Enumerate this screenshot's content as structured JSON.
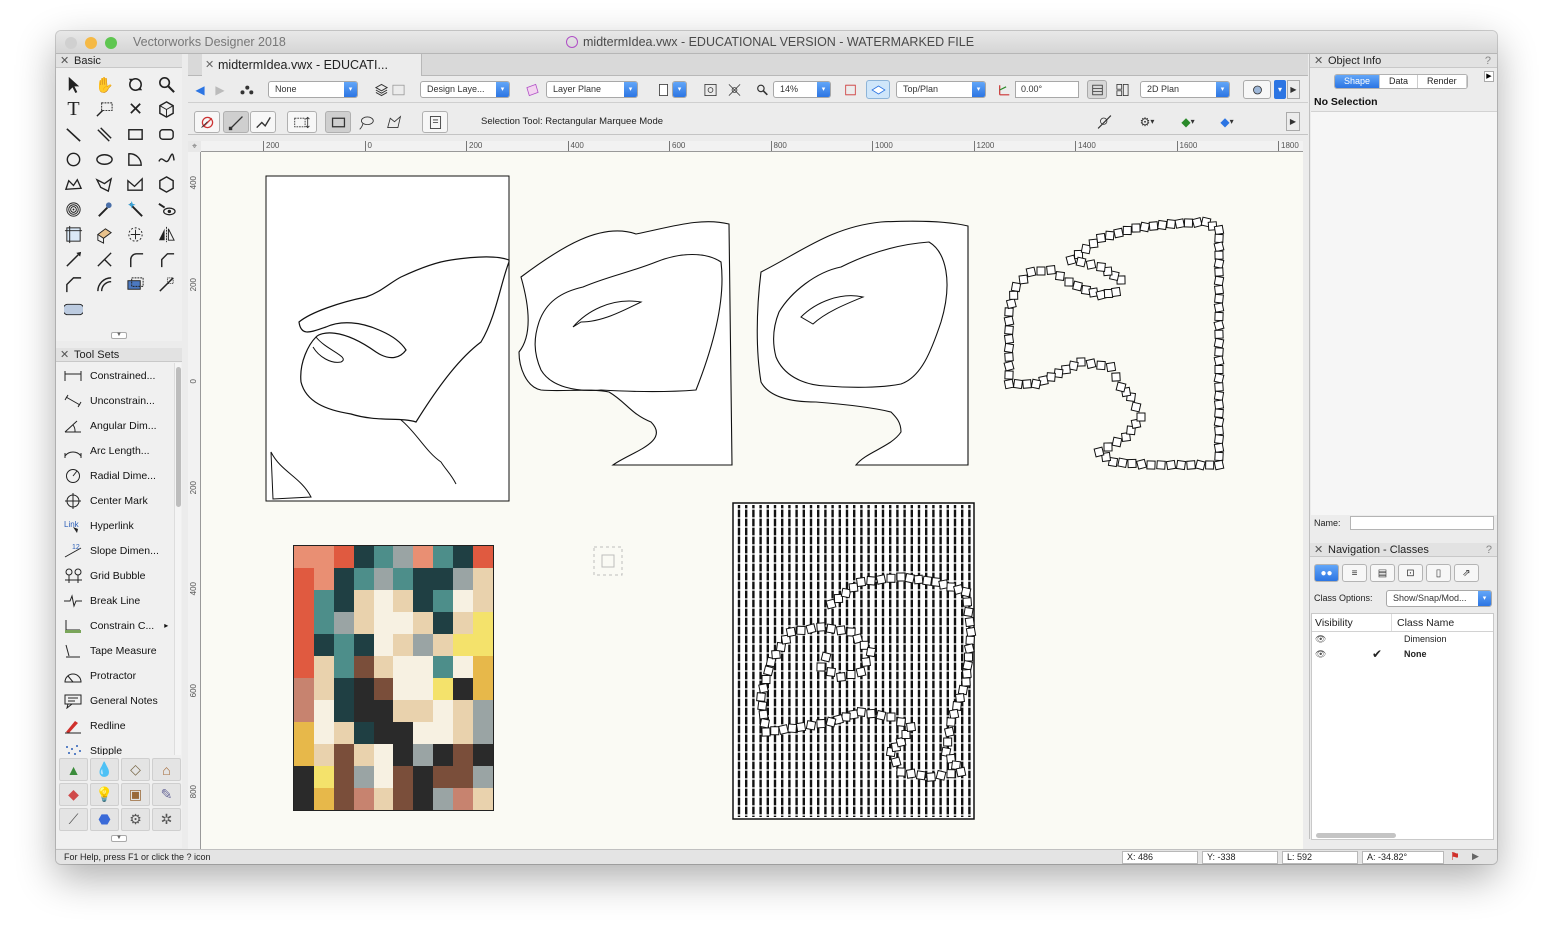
{
  "window": {
    "app_title": "Vectorworks Designer 2018",
    "document_title": "midtermIdea.vwx - EDUCATIONAL VERSION - WATERMARKED FILE",
    "traffic_lights": [
      "#d0d0d0",
      "#f5b945",
      "#5fc651"
    ]
  },
  "basic_palette": {
    "title": "Basic",
    "tools": [
      "selection-tool",
      "pan-tool",
      "flyover-tool",
      "zoom-tool",
      "text-tool",
      "callout-tool",
      "eraser-tool",
      "visualization-tool",
      "line-tool",
      "double-line-tool",
      "rectangle-tool",
      "rounded-rect-tool",
      "circle-tool",
      "oval-tool",
      "arc-tool",
      "freehand-tool",
      "polyline-tool",
      "polygon-tool",
      "double-polyline-tool",
      "regular-polygon-tool",
      "spiral-tool",
      "eyedropper-tool",
      "magic-wand-tool",
      "visibility-tool",
      "reshape-tool",
      "attribute-mapping-tool",
      "move-by-points-tool",
      "mirror-tool",
      "split-tool",
      "trim-tool",
      "fillet-tool",
      "chamfer-tool",
      "connect-tool",
      "offset-tool",
      "clip-tool",
      "clip-line-tool",
      "2d-reshape-tool"
    ]
  },
  "toolsets": {
    "title": "Tool Sets",
    "items": [
      {
        "label": "Constrained...",
        "icon": "constrained-dim-icon"
      },
      {
        "label": "Unconstrain...",
        "icon": "unconstrained-dim-icon"
      },
      {
        "label": "Angular Dim...",
        "icon": "angular-dim-icon"
      },
      {
        "label": "Arc Length...",
        "icon": "arc-length-icon"
      },
      {
        "label": "Radial Dime...",
        "icon": "radial-dim-icon"
      },
      {
        "label": "Center Mark",
        "icon": "center-mark-icon"
      },
      {
        "label": "Hyperlink",
        "icon": "hyperlink-icon"
      },
      {
        "label": "Slope Dimen...",
        "icon": "slope-dim-icon"
      },
      {
        "label": "Grid Bubble",
        "icon": "grid-bubble-icon"
      },
      {
        "label": "Break Line",
        "icon": "break-line-icon"
      },
      {
        "label": "Constrain C...",
        "icon": "constrain-icon",
        "submenu": "▸"
      },
      {
        "label": "Tape Measure",
        "icon": "tape-measure-icon"
      },
      {
        "label": "Protractor",
        "icon": "protractor-icon"
      },
      {
        "label": "General Notes",
        "icon": "general-notes-icon"
      },
      {
        "label": "Redline",
        "icon": "redline-icon"
      },
      {
        "label": "Stipple",
        "icon": "stipple-icon"
      }
    ],
    "set_icons": [
      "site-planning-set-icon",
      "landscape-set-icon",
      "building-shell-set-icon",
      "furniture-set-icon",
      "visualization-set-icon",
      "lighting-set-icon",
      "fabrication-set-icon",
      "detailing-set-icon",
      "dims-notes-set-icon",
      "piping-set-icon",
      "machine-components-set-icon",
      "more-sets-icon"
    ]
  },
  "tabs": {
    "active_label": "midtermIdea.vwx - EDUCATI...",
    "close_glyph": "✕"
  },
  "view_bar": {
    "class_value": "None",
    "layer_value": "Design Laye...",
    "plane_value": "Layer Plane",
    "zoom_value": "14%",
    "view_value": "Top/Plan",
    "rotation_value": "0.00°",
    "render_mode_value": "2D Plan"
  },
  "mode_bar": {
    "status_text": "Selection Tool: Rectangular Marquee Mode"
  },
  "rulers": {
    "top_labels": [
      "200",
      "0",
      "200",
      "400",
      "600",
      "800",
      "1000",
      "1200",
      "1400",
      "1600",
      "1800"
    ],
    "left_labels": [
      "400",
      "200",
      "0",
      "200",
      "400",
      "600",
      "800"
    ],
    "corner_glyph": "⌖"
  },
  "object_info": {
    "title": "Object Info",
    "tabs": [
      "Shape",
      "Data",
      "Render"
    ],
    "active_tab": "Shape",
    "selection": "No Selection",
    "name_label": "Name:",
    "name_value": "",
    "help_glyph": "?"
  },
  "navigation": {
    "title": "Navigation - Classes",
    "class_options_label": "Class Options:",
    "class_options_value": "Show/Snap/Mod...",
    "columns": [
      "Visibility",
      "Class Name"
    ],
    "rows": [
      {
        "name": "Dimension",
        "active": ""
      },
      {
        "name": "None",
        "active": "✔"
      }
    ]
  },
  "statusbar": {
    "help": "For Help, press F1 or click the ? icon",
    "x": "X:  486",
    "y": "Y:  -338",
    "l": "L:  592",
    "a": "A:  -34.82°"
  },
  "colors": {
    "accent": "#2c75e3",
    "canvas": "#fafaf4",
    "mosaic_palette": [
      "#e05a40",
      "#e98f73",
      "#4d8e8a",
      "#1f3f43",
      "#e9d2ad",
      "#f7f1e2",
      "#f4e26b",
      "#2a2a2a",
      "#7a4e3a",
      "#9aa4a4",
      "#c7836f",
      "#e7b84a"
    ]
  }
}
